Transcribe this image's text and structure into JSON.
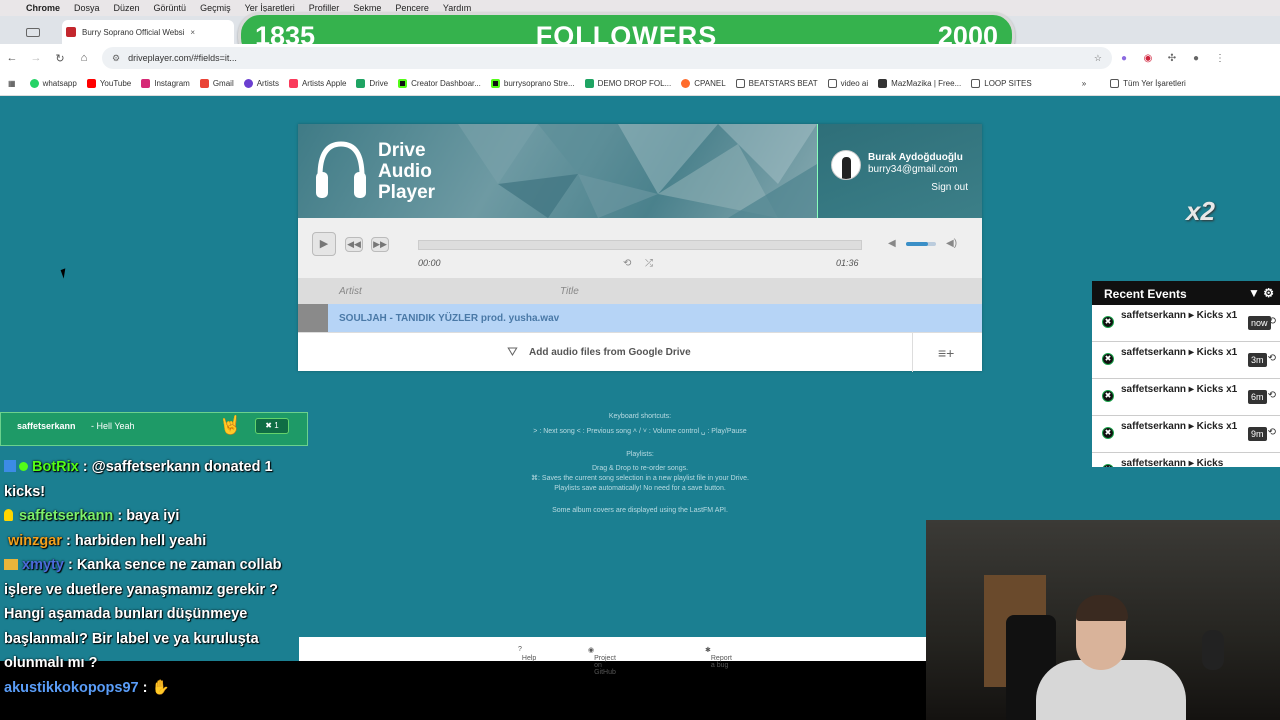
{
  "menubar": {
    "items": [
      "Chrome",
      "Dosya",
      "Düzen",
      "Görüntü",
      "Geçmiş",
      "Yer İşaretleri",
      "Profiller",
      "Sekme",
      "Pencere",
      "Yardım"
    ]
  },
  "tabs": {
    "first": "Burry Soprano Official Websi"
  },
  "followers": {
    "current": "1835",
    "label": "FOLLOWERS",
    "goal": "2000"
  },
  "address": {
    "url": "driveplayer.com/#fields=it..."
  },
  "bookmarks": {
    "items": [
      "whatsapp",
      "YouTube",
      "Instagram",
      "Gmail",
      "Artists",
      "Artists Apple",
      "Drive",
      "Creator Dashboar...",
      "burrysoprano Stre...",
      "DEMO DROP FOL...",
      "CPANEL",
      "BEATSTARS BEAT",
      "video ai",
      "MazMazika | Free...",
      "LOOP SITES"
    ],
    "overflow": "»",
    "all": "Tüm Yer İşaretleri"
  },
  "player": {
    "logo_line1": "Drive",
    "logo_line2": "Audio",
    "logo_line3": "Player",
    "user_name": "Burak Aydoğduoğlu",
    "user_email": "burry34@gmail.com",
    "sign_out": "Sign out",
    "time_current": "00:00",
    "time_total": "01:36",
    "col_artist": "Artist",
    "col_title": "Title",
    "song": "SOULJAH - TANIDIK YÜZLER prod. yusha.wav",
    "add_files": "Add audio files from Google Drive"
  },
  "shortcuts": {
    "title": "Keyboard shortcuts:",
    "line1": "˃ : Next song  ˂ : Previous song  ˄ / ˅ : Volume control  ␣ : Play/Pause",
    "playlists_title": "Playlists:",
    "line2": "Drag & Drop to re-order songs.",
    "line3": "⌘: Saves the current song selection in a new playlist file in your Drive.",
    "line4": "Playlists save automatically! No need for a save button.",
    "line5": "Some album covers are displayed using the LastFM API."
  },
  "footer": {
    "help": "Help",
    "github": "Project on GitHub",
    "bug": "Report a bug"
  },
  "alert": {
    "user": "saffetserkann",
    "message": "- Hell Yeah",
    "kicks": "1"
  },
  "chat": [
    {
      "user": "BotRix",
      "text": "@saffetserkann donated 1 kicks!"
    },
    {
      "user": "saffetserkann",
      "text": "baya iyi"
    },
    {
      "user": "winzgar",
      "text": "harbiden hell yeahi"
    },
    {
      "user": "xmyty",
      "text": "Kanka sence ne zaman collab işlere ve duetlere yanaşmamız gerekir ? Hangi aşamada bunları düşünmeye başlanmalı? Bir label ve ya kuruluşta olunmalı mı ?"
    },
    {
      "user": "akustikkokopops97",
      "text": ""
    }
  ],
  "events": {
    "title": "Recent Events",
    "items": [
      {
        "user": "saffetserkann",
        "action": "Kicks x1",
        "ago": "now"
      },
      {
        "user": "saffetserkann",
        "action": "Kicks x1",
        "ago": "3m"
      },
      {
        "user": "saffetserkann",
        "action": "Kicks x1",
        "ago": "6m"
      },
      {
        "user": "saffetserkann",
        "action": "Kicks x1",
        "ago": "9m"
      },
      {
        "user": "saffetserkann",
        "action": "Kicks",
        "ago": ""
      }
    ]
  },
  "multiplier": "x2",
  "colors": {
    "followers_bar": "#35b24d",
    "page_bg": "#1b7f91",
    "selected_row": "#b6d4f6",
    "kick_green": "#53fc18"
  }
}
